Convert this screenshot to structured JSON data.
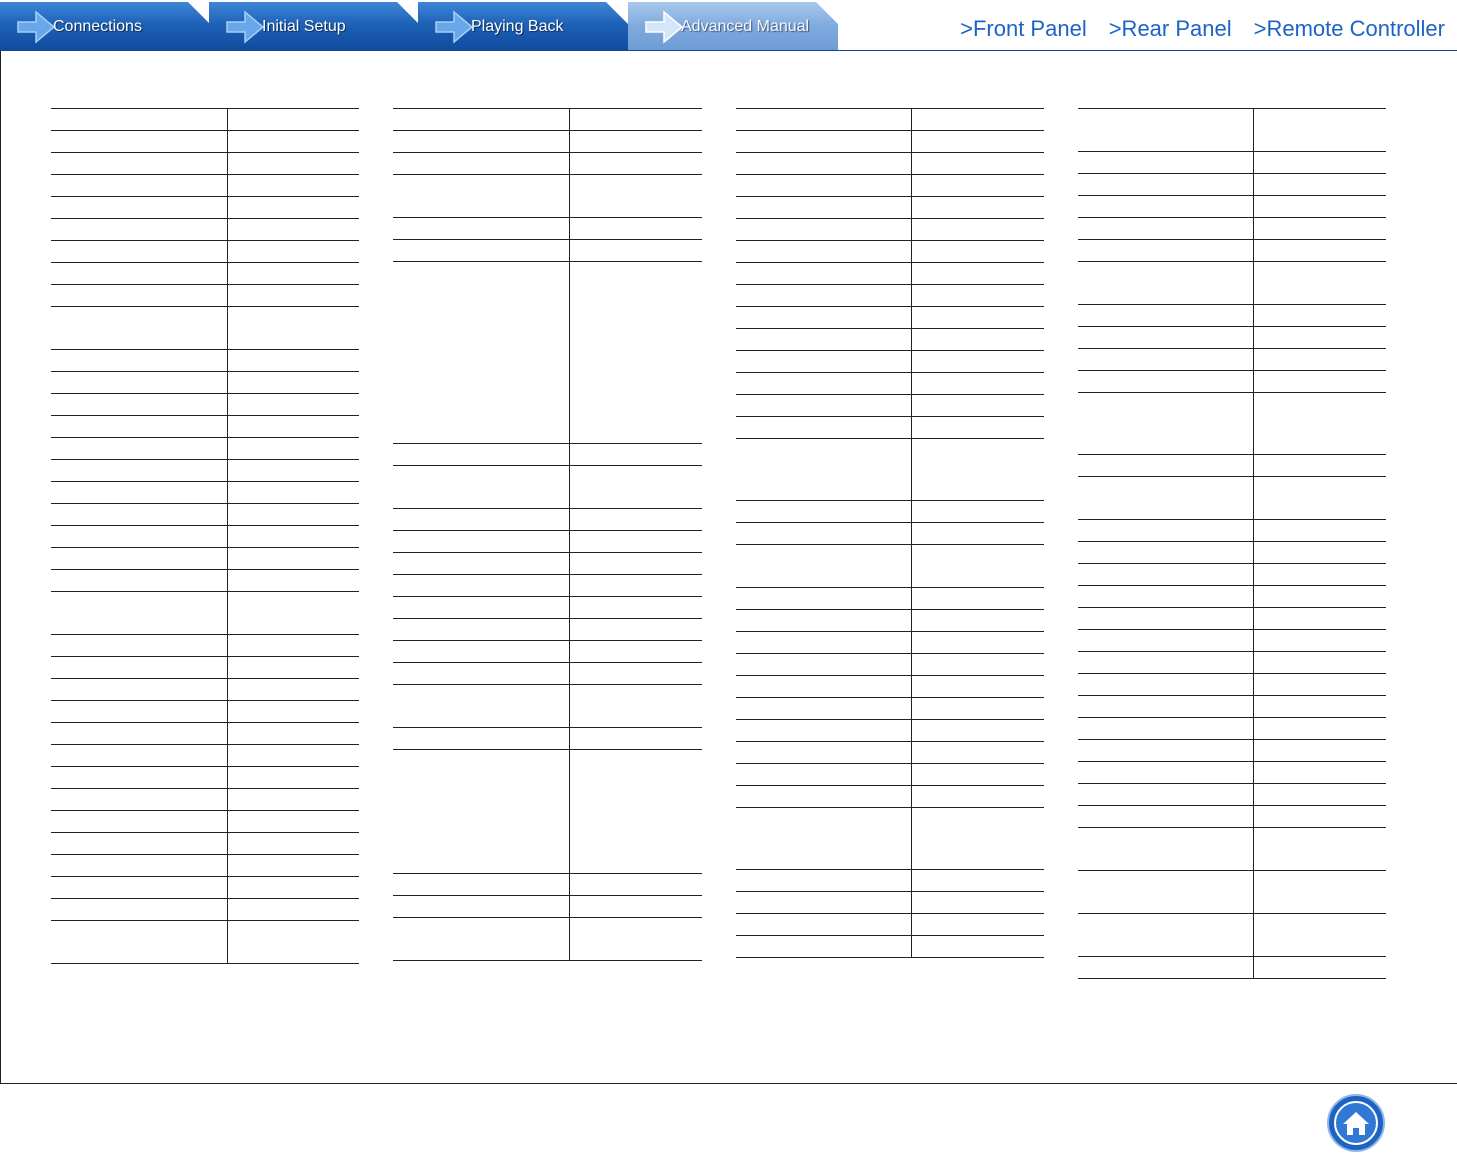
{
  "nav": {
    "tabs": [
      {
        "label": "Connections",
        "active": false
      },
      {
        "label": "Initial Setup",
        "active": false
      },
      {
        "label": "Playing Back",
        "active": false
      },
      {
        "label": "Advanced Manual",
        "active": true
      }
    ],
    "links": [
      ">Front Panel",
      ">Rear Panel",
      ">Remote Controller"
    ]
  },
  "colors": {
    "tab_blue": "#1e62b8",
    "tab_active": "#7eaadf",
    "link_blue": "#1b63c6",
    "rule": "#222222"
  },
  "icons": {
    "tab_arrow": "arrow-right-icon",
    "home": "home-icon"
  }
}
